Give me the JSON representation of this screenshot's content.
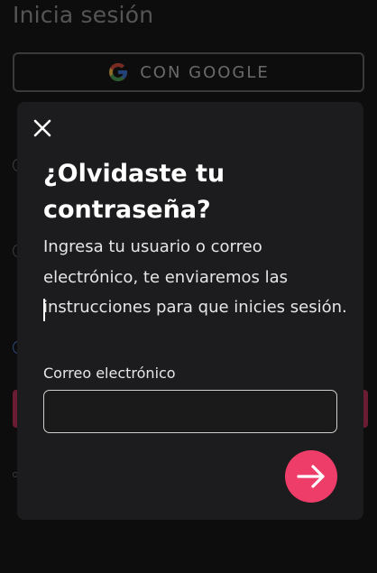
{
  "background": {
    "title": "Inicia sesión",
    "google_button_label": "CON GOOGLE"
  },
  "modal": {
    "title": "¿Olvidaste tu contraseña?",
    "description": "Ingresa tu usuario o correo electrónico, te enviaremos las instrucciones para que inicies sesión.",
    "email_label": "Correo electrónico",
    "email_value": "",
    "close_icon": "close-icon",
    "submit_icon": "arrow-right-icon"
  },
  "colors": {
    "accent": "#ef3d6a",
    "modal_bg": "#1c1c1e",
    "page_bg": "#0d0d0d"
  }
}
